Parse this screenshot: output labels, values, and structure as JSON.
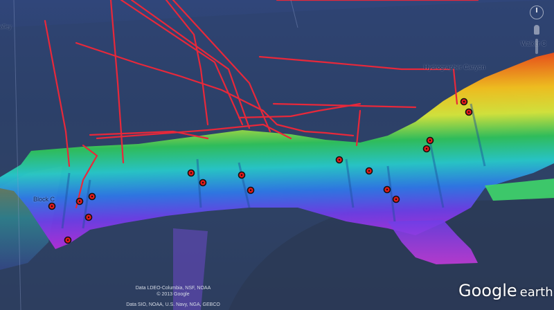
{
  "labels": {
    "valley": "alley",
    "hydrographer": "Hydrographer Canyon",
    "block": "Block C",
    "walker": "Walker C"
  },
  "attribution": {
    "line1": "Data LDEO-Columbia, NSF, NOAA",
    "line2": "© 2013 Google",
    "line3": "Data SIO, NOAA, U.S. Navy, NGA, GEBCO"
  },
  "logo": {
    "google": "Google",
    "earth": "earth"
  },
  "icons": {
    "marker": "dive-site-marker-icon",
    "compass": "compass-icon",
    "pegman": "street-view-icon",
    "zoom": "zoom-slider-icon"
  },
  "colors": {
    "ocean": "#2b3f66",
    "track": "#e8283a",
    "marker_ring": "#111111",
    "marker_fill": "#e11a1a",
    "depth_shallow": "#e0201e",
    "depth_mid": "#2fc25a",
    "depth_deep": "#9b2fe0",
    "label_text": "#0e2454"
  }
}
